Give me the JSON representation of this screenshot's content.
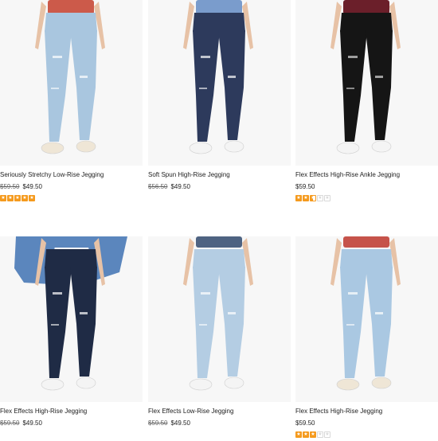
{
  "products": [
    {
      "name": "Seriously Stretchy Low-Rise Jegging",
      "original_price": "$59.50",
      "sale_price": "$49.50",
      "rating": 5,
      "rating_max": 5,
      "colors": {
        "denim": "#a9c6df",
        "top": "#cc5a4a",
        "shoe": "#efe6d6",
        "bg": "#f7f7f7"
      },
      "image_icon": "jeans-photo"
    },
    {
      "name": "Soft Spun High-Rise Jegging",
      "original_price": "$56.50",
      "sale_price": "$49.50",
      "rating": 0,
      "rating_max": 5,
      "colors": {
        "denim": "#2d3a5c",
        "top": "#7a9ccc",
        "shoe": "#f4f4f4",
        "bg": "#f7f7f7"
      },
      "image_icon": "jeans-photo"
    },
    {
      "name": "Flex Effects High-Rise Ankle Jegging",
      "original_price": "",
      "sale_price": "$59.50",
      "rating": 2.5,
      "rating_max": 5,
      "colors": {
        "denim": "#151515",
        "top": "#6b1f2a",
        "shoe": "#f4f4f4",
        "bg": "#f7f7f7"
      },
      "image_icon": "jeans-photo"
    },
    {
      "name": "Flex Effects High-Rise Jegging",
      "original_price": "$59.50",
      "sale_price": "$49.50",
      "rating": 0,
      "rating_max": 5,
      "colors": {
        "denim": "#1f2b45",
        "top": "#5b86bd",
        "shoe": "#f4f4f4",
        "bg": "#f7f7f7"
      },
      "image_icon": "jeans-photo"
    },
    {
      "name": "Flex Effects Low-Rise Jegging",
      "original_price": "$59.50",
      "sale_price": "$49.50",
      "rating": 0,
      "rating_max": 5,
      "colors": {
        "denim": "#b4cde3",
        "top": "#4e6382",
        "shoe": "#f4f4f4",
        "bg": "#f7f7f7"
      },
      "image_icon": "jeans-photo"
    },
    {
      "name": "Flex Effects High-Rise Jegging",
      "original_price": "",
      "sale_price": "$59.50",
      "rating": 3,
      "rating_max": 5,
      "colors": {
        "denim": "#aac8e2",
        "top": "#c6534a",
        "shoe": "#efe6d6",
        "bg": "#f7f7f7"
      },
      "image_icon": "jeans-photo"
    }
  ],
  "theme": {
    "star_color": "#f59a1d",
    "star_empty": "#d8d8d8"
  }
}
